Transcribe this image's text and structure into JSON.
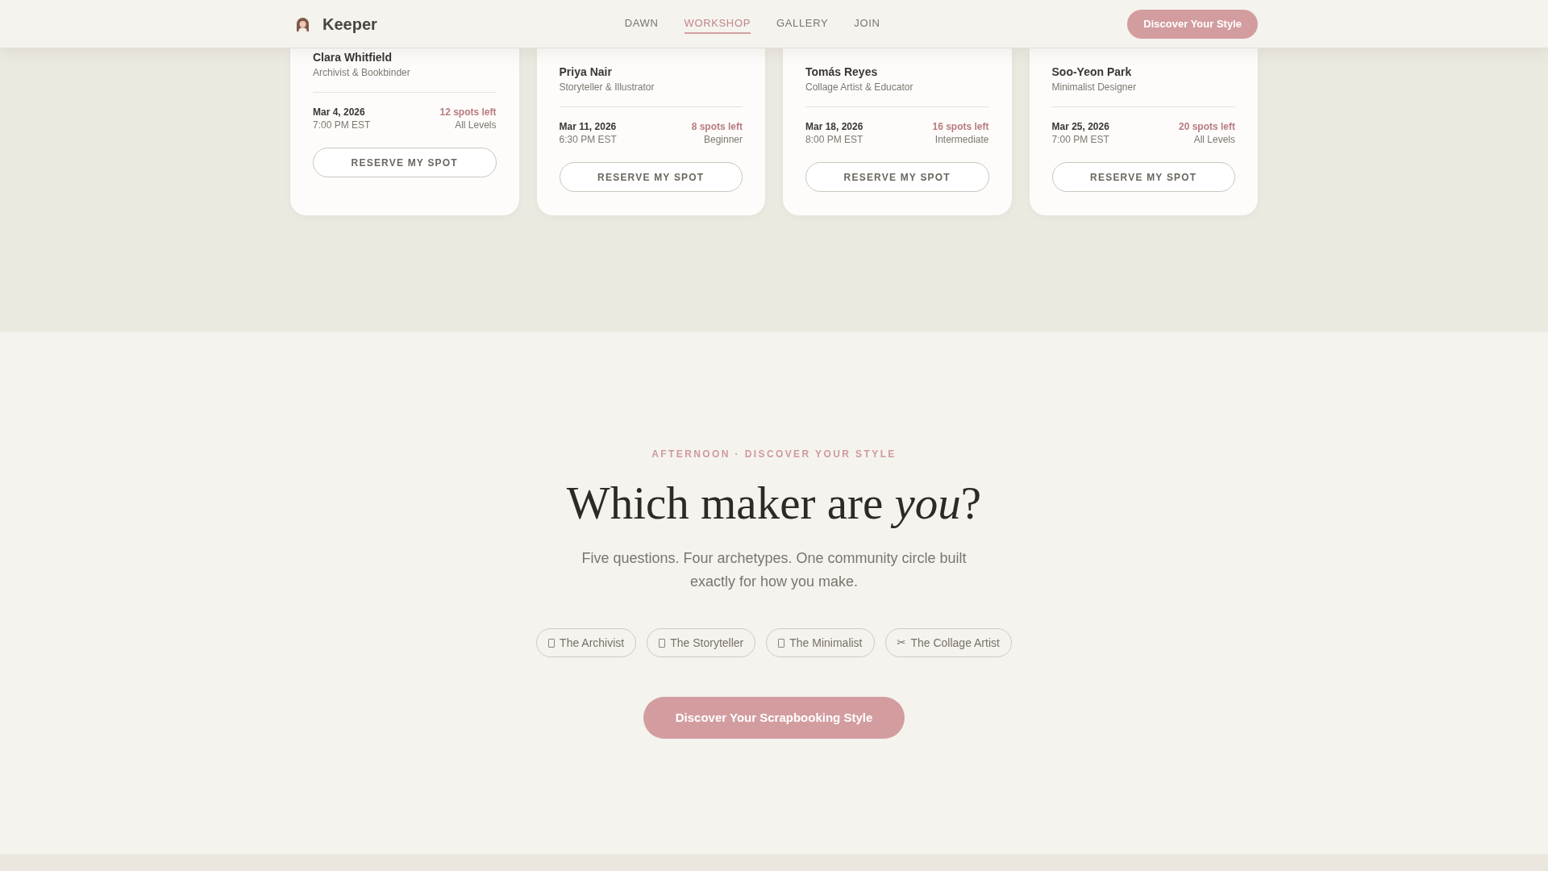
{
  "header": {
    "brand": "Keeper",
    "nav": [
      {
        "label": "DAWN",
        "selected": false
      },
      {
        "label": "WORKSHOP",
        "selected": true
      },
      {
        "label": "GALLERY",
        "selected": false
      },
      {
        "label": "JOIN",
        "selected": false
      }
    ],
    "cta": "Discover Your Style"
  },
  "workshops": [
    {
      "host": "Clara Whitfield",
      "role": "Archivist & Bookbinder",
      "date": "Mar 4, 2026",
      "time": "7:00 PM EST",
      "spots": "12 spots left",
      "skill_level": "All Levels",
      "button": "RESERVE MY SPOT"
    },
    {
      "host": "Priya Nair",
      "role": "Storyteller & Illustrator",
      "date": "Mar 11, 2026",
      "time": "6:30 PM EST",
      "spots": "8 spots left",
      "skill_level": "Beginner",
      "button": "RESERVE MY SPOT"
    },
    {
      "host": "Tomás Reyes",
      "role": "Collage Artist & Educator",
      "date": "Mar 18, 2026",
      "time": "8:00 PM EST",
      "spots": "16 spots left",
      "skill_level": "Intermediate",
      "button": "RESERVE MY SPOT"
    },
    {
      "host": "Soo-Yeon Park",
      "role": "Minimalist Designer",
      "date": "Mar 25, 2026",
      "time": "7:00 PM EST",
      "spots": "20 spots left",
      "skill_level": "All Levels",
      "button": "RESERVE MY SPOT"
    }
  ],
  "quiz": {
    "eyebrow": "AFTERNOON · DISCOVER YOUR STYLE",
    "heading": "Which maker are *you*?",
    "intro": "Five questions. Four archetypes. One community circle built exactly for how you make.",
    "archetypes": [
      {
        "kind": "missing-glyph",
        "label": "The Archivist"
      },
      {
        "kind": "missing-glyph",
        "label": "The Storyteller"
      },
      {
        "kind": "missing-glyph",
        "label": "The Minimalist"
      },
      {
        "kind": "symbol",
        "symbol": "✂",
        "label": "The Collage Artist"
      }
    ],
    "button": "Discover Your Scrapbooking Style"
  }
}
